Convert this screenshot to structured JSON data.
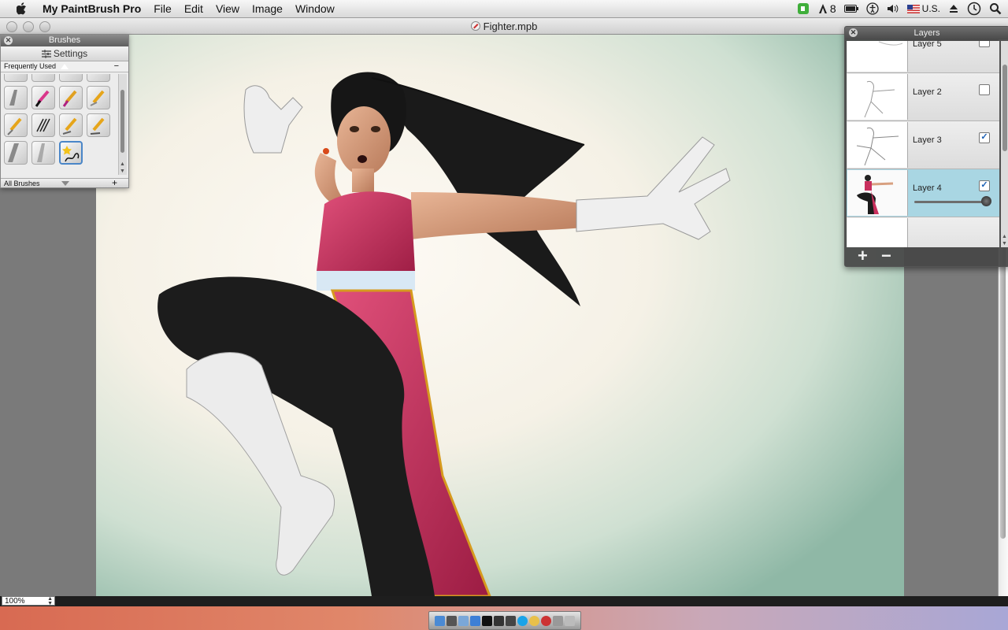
{
  "menubar": {
    "app_name": "My PaintBrush Pro",
    "menus": [
      "File",
      "Edit",
      "View",
      "Image",
      "Window"
    ],
    "status_number": "8",
    "input_source": "U.S."
  },
  "document": {
    "title": "Fighter.mpb",
    "zoom": "100%"
  },
  "brushes_panel": {
    "title": "Brushes",
    "settings_label": "Settings",
    "category": "Frequently Used",
    "footer_category": "All Brushes"
  },
  "layers_panel": {
    "title": "Layers",
    "layers": [
      {
        "name": "Layer 5",
        "visible": false,
        "selected": false
      },
      {
        "name": "Layer 2",
        "visible": false,
        "selected": false
      },
      {
        "name": "Layer 3",
        "visible": true,
        "selected": false
      },
      {
        "name": "Layer 4",
        "visible": true,
        "selected": true
      }
    ],
    "add_label": "+",
    "remove_label": "−"
  },
  "colors": {
    "selected_layer": "#a9d6e3",
    "checkbox_mark": "#1a5fb4",
    "outfit_pink": "#c9305e",
    "outfit_black": "#1b1b1b",
    "canvas_bg": "#fbf7ef"
  }
}
